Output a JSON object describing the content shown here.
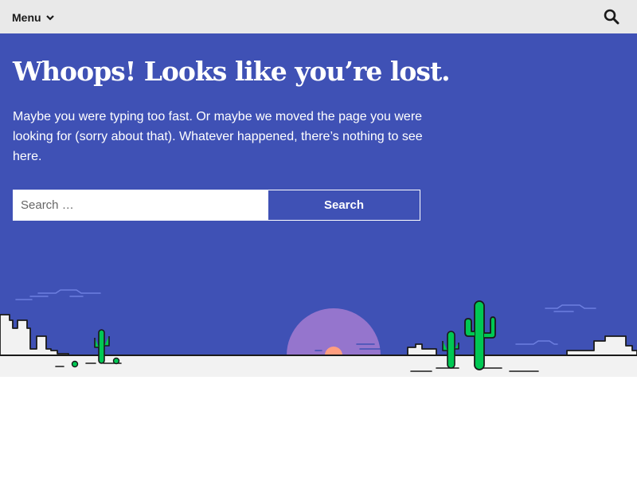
{
  "header": {
    "menu_label": "Menu",
    "menu_icon": "chevron-down-icon",
    "search_icon": "search-icon"
  },
  "error": {
    "title": "Whoops! Looks like you’re lost.",
    "description": "Maybe you were typing too fast. Or maybe we moved the page you were looking for (sorry about that). Whatever happened, there’s nothing to see here."
  },
  "search": {
    "placeholder": "Search …",
    "value": "",
    "submit_label": "Search"
  },
  "colors": {
    "hero_background": "#3f51b5",
    "header_background": "#e9e9e9",
    "sun": "#9575cd",
    "sun_core": "#ff9e80",
    "cactus": "#00c853",
    "ground": "#f2f2f2"
  }
}
